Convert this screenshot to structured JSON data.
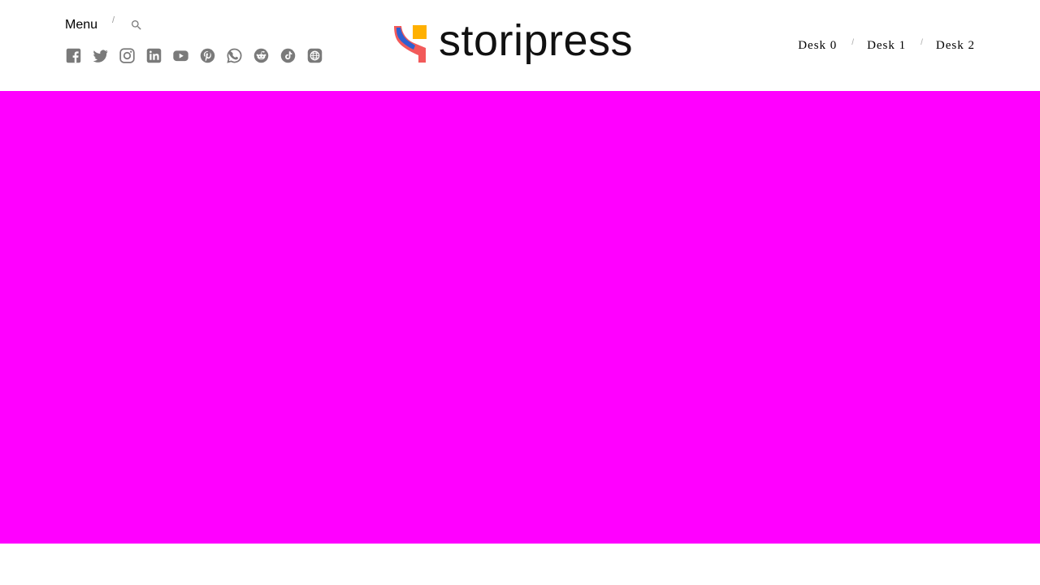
{
  "header": {
    "menu_label": "Menu",
    "separator": "/",
    "search": {
      "icon": "search-icon"
    },
    "social": [
      {
        "name": "facebook",
        "icon": "facebook-icon"
      },
      {
        "name": "twitter",
        "icon": "twitter-icon"
      },
      {
        "name": "instagram",
        "icon": "instagram-icon"
      },
      {
        "name": "linkedin",
        "icon": "linkedin-icon"
      },
      {
        "name": "youtube",
        "icon": "youtube-icon"
      },
      {
        "name": "pinterest",
        "icon": "pinterest-icon"
      },
      {
        "name": "whatsapp",
        "icon": "whatsapp-icon"
      },
      {
        "name": "reddit",
        "icon": "reddit-icon"
      },
      {
        "name": "tiktok",
        "icon": "tiktok-icon"
      },
      {
        "name": "website",
        "icon": "globe-icon"
      }
    ],
    "icon_color": "#7a7a7a"
  },
  "logo": {
    "text": "storipress",
    "colors": {
      "red": "#f25a5a",
      "blue": "#2f5fd0",
      "yellow": "#ffb000"
    }
  },
  "nav": {
    "desks": [
      "Desk 0",
      "Desk 1",
      "Desk 2"
    ],
    "separator": "/"
  },
  "hero": {
    "background": "#ff00ff"
  }
}
